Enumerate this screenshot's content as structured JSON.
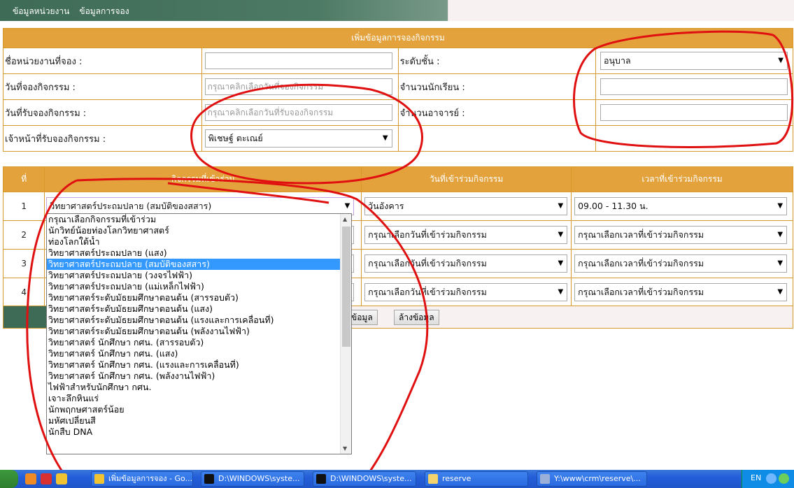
{
  "nav": {
    "items": [
      "ข้อมูลหน่วยงาน",
      "ข้อมูลการจอง"
    ]
  },
  "form": {
    "header": "เพิ่มข้อมูลการจองกิจกรรม",
    "unit_label": "ชื่อหน่วยงานที่จอง :",
    "unit_value": "",
    "level_label": "ระดับชั้น :",
    "level_value": "อนุบาล",
    "booking_date_label": "วันที่จองกิจกรรม :",
    "booking_date_placeholder": "กรุณาคลิกเลือกวันที่จองกิจกรรม",
    "students_label": "จำนวนนักเรียน :",
    "students_value": "",
    "receive_date_label": "วันที่รับจองกิจกรรม :",
    "receive_date_placeholder": "กรุณาคลิกเลือกวันที่รับจองกิจกรรม",
    "teachers_label": "จำนวนอาจารย์ :",
    "teachers_value": "",
    "staff_label": "เจ้าหน้าที่รับจองกิจกรรม :",
    "staff_value": "พิเชษฐ์ ตะเณย์"
  },
  "activities": {
    "col_no": "ที่",
    "col_activity": "กิจกรรมที่เข้าร่วม",
    "col_date": "วันที่เข้าร่วมกิจกรรม",
    "col_time": "เวลาที่เข้าร่วมกิจกรรม",
    "rows": [
      {
        "no": "1",
        "activity": "วิทยาศาสตร์ประถมปลาย (สมบัติของสสาร)",
        "date": "วันอังคาร",
        "time": "09.00 - 11.30 น."
      },
      {
        "no": "2",
        "activity": "",
        "date": "กรุณาเลือกวันที่เข้าร่วมกิจกรรม",
        "time": "กรุณาเลือกเวลาที่เข้าร่วมกิจกรรม"
      },
      {
        "no": "3",
        "activity": "",
        "date": "กรุณาเลือกวันที่เข้าร่วมกิจกรรม",
        "time": "กรุณาเลือกเวลาที่เข้าร่วมกิจกรรม"
      },
      {
        "no": "4",
        "activity": "",
        "date": "กรุณาเลือกวันที่เข้าร่วมกิจกรรม",
        "time": "กรุณาเลือกเวลาที่เข้าร่วมกิจกรรม"
      }
    ]
  },
  "buttons": {
    "save": "ข้อมูล",
    "clear": "ล้างข้อมูล"
  },
  "dropdown": {
    "selected_index": 4,
    "options": [
      "กรุณาเลือกกิจกรรมที่เข้าร่วม",
      "นักวิทย์น้อยท่องโลกวิทยาศาสตร์",
      "ท่องโลกใต้น้ำ",
      "วิทยาศาสตร์ประถมปลาย (แสง)",
      "วิทยาศาสตร์ประถมปลาย (สมบัติของสสาร)",
      "วิทยาศาสตร์ประถมปลาย (วงจรไฟฟ้า)",
      "วิทยาศาสตร์ประถมปลาย (แม่เหล็กไฟฟ้า)",
      "วิทยาศาสตร์ระดับมัธยมศึกษาตอนต้น (สารรอบตัว)",
      "วิทยาศาสตร์ระดับมัธยมศึกษาตอนต้น (แสง)",
      "วิทยาศาสตร์ระดับมัธยมศึกษาตอนต้น (แรงและการเคลื่อนที่)",
      "วิทยาศาสตร์ระดับมัธยมศึกษาตอนต้น (พลังงานไฟฟ้า)",
      "วิทยาศาสตร์ นักศึกษา กศน. (สารรอบตัว)",
      "วิทยาศาสตร์ นักศึกษา กศน. (แสง)",
      "วิทยาศาสตร์ นักศึกษา กศน. (แรงและการเคลื่อนที่)",
      "วิทยาศาสตร์ นักศึกษา กศน. (พลังงานไฟฟ้า)",
      "ไฟฟ้าสำหรับนักศึกษา กศน.",
      "เจาะลึกหินแร่",
      "นักพฤกษศาสตร์น้อย",
      "มหัศเปลี่ยนสี",
      "นักสืบ DNA"
    ]
  },
  "taskbar": {
    "tasks": [
      "เพิ่มข้อมูลการจอง - Go...",
      "D:\\WINDOWS\\syste...",
      "D:\\WINDOWS\\syste...",
      "reserve",
      "Y:\\www\\crm\\reserve\\..."
    ],
    "lang": "EN"
  },
  "colors": {
    "nav": "#3e6b56",
    "header": "#e3a23c",
    "border": "#d59a2a",
    "annotation": "#e01010",
    "highlight": "#3399ff"
  }
}
